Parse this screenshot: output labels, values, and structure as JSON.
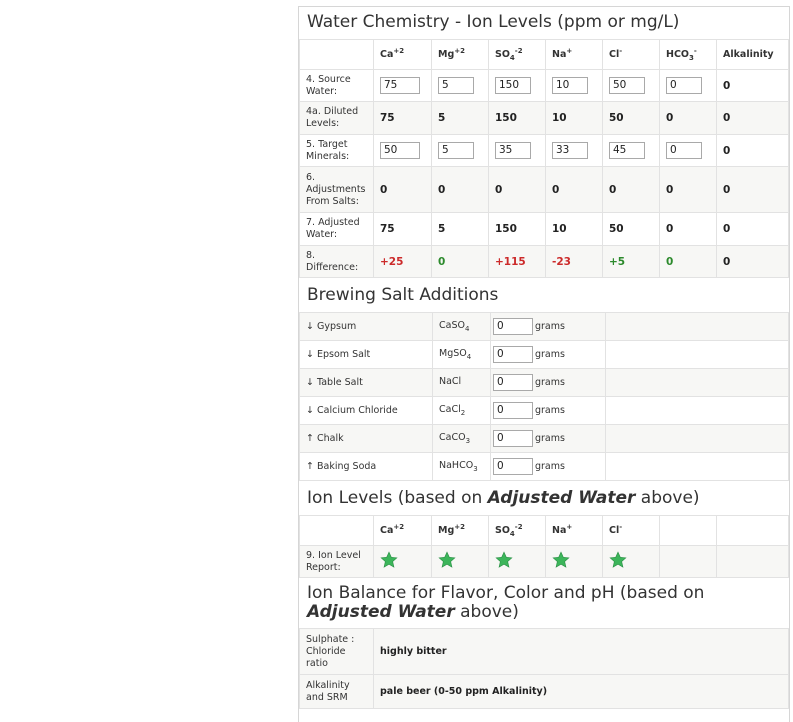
{
  "water_chemistry": {
    "title": "Water Chemistry - Ion Levels (ppm or mg/L)",
    "columns": [
      {
        "base": "Ca",
        "sup": "+2",
        "sub": ""
      },
      {
        "base": "Mg",
        "sup": "+2",
        "sub": ""
      },
      {
        "base": "SO",
        "sub": "4",
        "sup": "-2"
      },
      {
        "base": "Na",
        "sup": "+",
        "sub": ""
      },
      {
        "base": "Cl",
        "sup": "-",
        "sub": ""
      },
      {
        "base": "HCO",
        "sub": "3",
        "sup": "-"
      },
      {
        "base": "Alkalinity",
        "sup": "",
        "sub": ""
      }
    ],
    "rows": [
      {
        "label": "4. Source Water:",
        "type": "input",
        "values": [
          "75",
          "5",
          "150",
          "10",
          "50",
          "0",
          "0"
        ]
      },
      {
        "label": "4a. Diluted Levels:",
        "type": "text",
        "values": [
          "75",
          "5",
          "150",
          "10",
          "50",
          "0",
          "0"
        ]
      },
      {
        "label": "5. Target Minerals:",
        "type": "input",
        "values": [
          "50",
          "5",
          "35",
          "33",
          "45",
          "0",
          "0"
        ]
      },
      {
        "label": "6. Adjustments From Salts:",
        "type": "text",
        "values": [
          "0",
          "0",
          "0",
          "0",
          "0",
          "0",
          "0"
        ]
      },
      {
        "label": "7. Adjusted Water:",
        "type": "text",
        "values": [
          "75",
          "5",
          "150",
          "10",
          "50",
          "0",
          "0"
        ]
      },
      {
        "label": "8. Difference:",
        "type": "diff",
        "values": [
          "+25",
          "0",
          "+115",
          "-23",
          "+5",
          "0",
          "0"
        ]
      }
    ],
    "colors": {
      "negative_diff": "#cc2a2a",
      "positive_diff": "#2c8a2c"
    }
  },
  "brewing_salts": {
    "title": "Brewing Salt Additions",
    "units_label": "grams",
    "items": [
      {
        "arrow": "↓",
        "name": "Gypsum",
        "formula_base": "CaSO",
        "formula_sub": "4",
        "value": "0"
      },
      {
        "arrow": "↓",
        "name": "Epsom Salt",
        "formula_base": "MgSO",
        "formula_sub": "4",
        "value": "0"
      },
      {
        "arrow": "↓",
        "name": "Table Salt",
        "formula_base": "NaCl",
        "formula_sub": "",
        "value": "0"
      },
      {
        "arrow": "↓",
        "name": "Calcium Chloride",
        "formula_base": "CaCl",
        "formula_sub": "2",
        "value": "0"
      },
      {
        "arrow": "↑",
        "name": "Chalk",
        "formula_base": "CaCO",
        "formula_sub": "3",
        "value": "0"
      },
      {
        "arrow": "↑",
        "name": "Baking Soda",
        "formula_base": "NaHCO",
        "formula_sub": "3",
        "value": "0"
      }
    ]
  },
  "ion_levels": {
    "title_pre": "Ion Levels (based on ",
    "title_em": "Adjusted Water",
    "title_post": " above)",
    "columns": [
      {
        "base": "Ca",
        "sup": "+2",
        "sub": ""
      },
      {
        "base": "Mg",
        "sup": "+2",
        "sub": ""
      },
      {
        "base": "SO",
        "sub": "4",
        "sup": "-2"
      },
      {
        "base": "Na",
        "sup": "+",
        "sub": ""
      },
      {
        "base": "Cl",
        "sup": "-",
        "sub": ""
      }
    ],
    "report_label": "9. Ion Level Report:",
    "report_icons": [
      "star-icon",
      "star-icon",
      "star-icon",
      "star-icon",
      "star-icon"
    ],
    "star_color": "#3cb55a"
  },
  "ion_balance": {
    "title_pre": "Ion Balance for Flavor, Color and pH (based on ",
    "title_em": "Adjusted Water",
    "title_post": " above)",
    "rows": [
      {
        "label": "Sulphate : Chloride ratio",
        "value": "highly bitter"
      },
      {
        "label": "Alkalinity and SRM",
        "value": "pale beer (0-50 ppm Alkalinity)"
      }
    ]
  }
}
